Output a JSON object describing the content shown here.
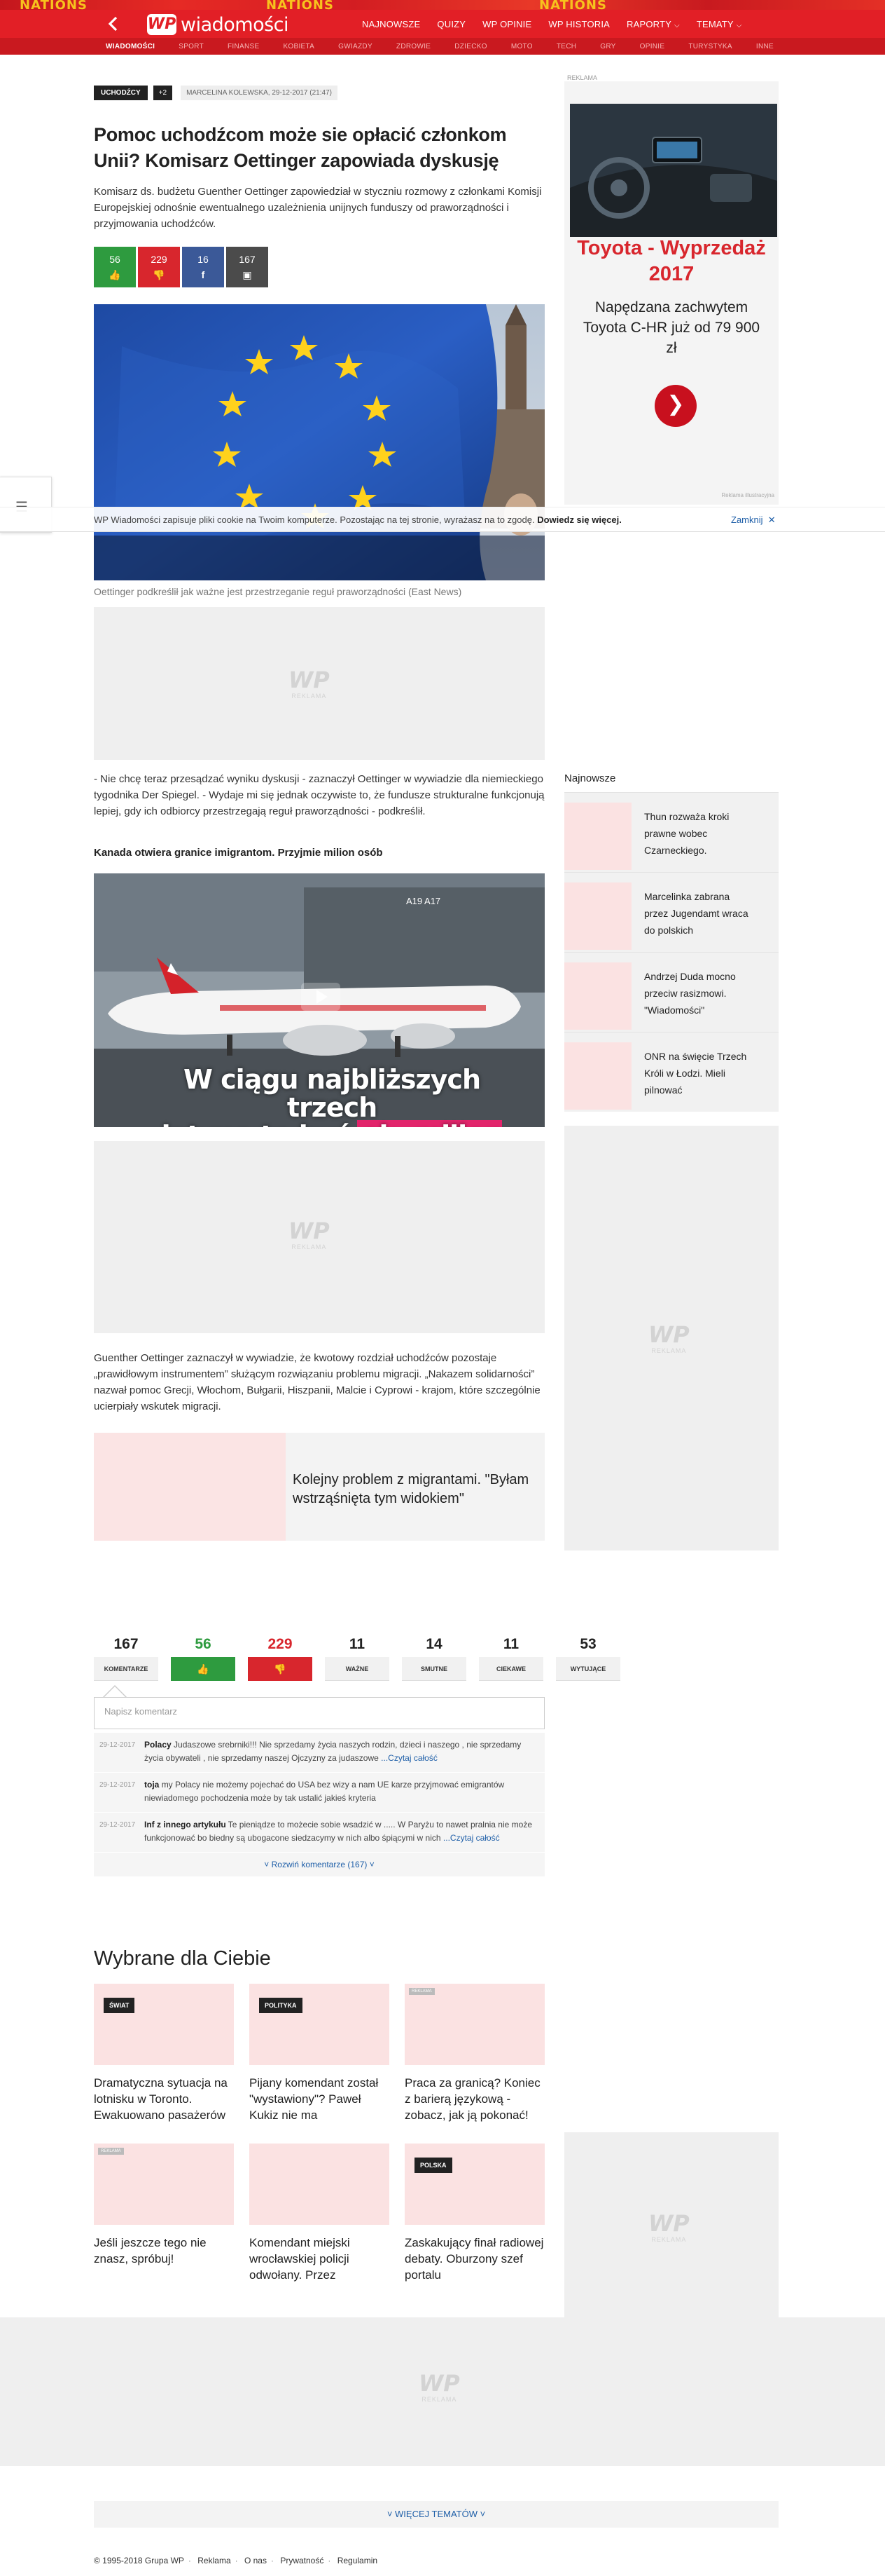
{
  "header": {
    "promo_text": "NATIONS",
    "logo_mark": "WP",
    "logo_text": "wiadomości",
    "back_icon": "chevron-left-icon",
    "top_nav": [
      {
        "label": "NAJNOWSZE"
      },
      {
        "label": "QUIZY"
      },
      {
        "label": "WP OPINIE"
      },
      {
        "label": "WP HISTORIA"
      },
      {
        "label": "RAPORTY"
      },
      {
        "label": "TEMATY"
      }
    ],
    "sub_nav": [
      {
        "label": "WIADOMOŚCI"
      },
      {
        "label": "SPORT"
      },
      {
        "label": "FINANSE"
      },
      {
        "label": "KOBIETA"
      },
      {
        "label": "GWIAZDY"
      },
      {
        "label": "ZDROWIE"
      },
      {
        "label": "DZIECKO"
      },
      {
        "label": "MOTO"
      },
      {
        "label": "TECH"
      },
      {
        "label": "GRY"
      },
      {
        "label": "OPINIE"
      },
      {
        "label": "TURYSTYKA"
      },
      {
        "label": "INNE"
      }
    ],
    "brand_color": "#e21f26"
  },
  "article": {
    "tag": "UCHODŹCY",
    "tag_more": "+2",
    "meta": "MARCELINA KOLEWSKA, 29-12-2017 (21:47)",
    "title": "Pomoc uchodźcom może sie opłacić członkom Unii? Komisarz Oettinger zapowiada dyskusję",
    "lead": "Komisarz ds. budżetu Guenther Oettinger zapowiedział w styczniu rozmowy z członkami Komisji Europejskiej odnośnie ewentualnego uzależnienia unijnych funduszy od praworządności i przyjmowania uchodźców.",
    "votes": {
      "up": "56",
      "down": "229",
      "facebook": "16",
      "comments": "167"
    },
    "caption": "Oettinger podkreślił jak ważne jest przestrzeganie reguł praworządności (East News)",
    "para1": "- Nie chcę teraz przesądzać wyniku dyskusji - zaznaczył Oettinger w wywiadzie dla niemieckiego tygodnika Der Spiegel. - Wydaje mi się jednak oczywiste to, że fundusze strukturalne funkcjonują lepiej, gdy ich odbiorcy przestrzegają reguł praworządności - podkreślił.",
    "video_heading": "Kanada otwiera granice imigrantom. Przyjmie milion osób",
    "video_caption_line1": "W ciągu najbliższych trzech",
    "video_caption_line2": "lat ma to być",
    "video_caption_highlight": "ok. milion osób",
    "video_tail_label": "A19 A17",
    "para2": "Guenther Oettinger zaznaczył w wywiadzie, że kwotowy rozdział uchodźców pozostaje „prawidłowym instrumentem” służącym rozwiązaniu problemu migracji. „Nakazem solidarności” nazwał pomoc Grecji, Włochom, Bułgarii, Hiszpanii, Malcie i Cyprowi - krajom, które szczególnie ucierpiały wskutek migracji.",
    "related": "Kolejny problem z migrantami. \"Byłam wstrząśnięta tym widokiem\""
  },
  "ads": {
    "reklama_label": "REKLAMA",
    "wp_mark": "WP",
    "side_label": "REKLAMA",
    "toyota_title": "Toyota - Wyprzedaż 2017",
    "toyota_text": "Napędzana zachwytem Toyota C-HR już od 79 900 zł",
    "toyota_credit": "Reklama illustracyjna",
    "toyota_btn_icon": "chevron-right-icon"
  },
  "cookie": {
    "text": "WP Wiadomości zapisuje pliki cookie na Twoim komputerze. Pozostając na tej stronie, wyrażasz na to zgodę.",
    "link": "Dowiedz się więcej.",
    "close": "Zamknij"
  },
  "sidebar": {
    "najnowsze_heading": "Najnowsze",
    "najnowsze": [
      {
        "title": "Thun rozważa kroki prawne wobec Czarneckiego."
      },
      {
        "title": "Marcelinka zabrana przez Jugendamt wraca do polskich"
      },
      {
        "title": "Andrzej Duda mocno przeciw rasizmowi. \"Wiadomości\""
      },
      {
        "title": "ONR na święcie Trzech Króli w Łodzi. Mieli pilnować"
      }
    ]
  },
  "reactions": [
    {
      "count": "167",
      "label": "KOMENTARZE"
    },
    {
      "count": "56",
      "label": "👍"
    },
    {
      "count": "229",
      "label": "👎"
    },
    {
      "count": "11",
      "label": "WAŻNE"
    },
    {
      "count": "14",
      "label": "SMUTNE"
    },
    {
      "count": "11",
      "label": "CIEKAWE"
    },
    {
      "count": "53",
      "label": "WYTUJĄCE"
    }
  ],
  "comments": {
    "placeholder": "Napisz komentarz",
    "items": [
      {
        "date": "29-12-2017",
        "author": "Polacy",
        "text": "Judaszowe srebrniki!!! Nie sprzedamy życia naszych rodzin, dzieci i naszego , nie sprzedamy życia obywateli , nie sprzedamy naszej Ojczyzny za judaszowe",
        "more": "...Czytaj całość"
      },
      {
        "date": "29-12-2017",
        "author": "toja",
        "text": "my Polacy nie możemy pojechać do USA bez wizy a nam UE karze przyjmować emigrantów niewiadomego pochodzenia może by tak ustalić jakieś kryteria",
        "more": ""
      },
      {
        "date": "29-12-2017",
        "author": "Inf z innego artykułu",
        "text": "Te pieniądze to możecie sobie wsadzić w ..... W Paryżu to nawet pralnia nie może funkcjonować bo biedny są ubogacone siedzacymy w nich albo śpiącymi w nich",
        "more": "...Czytaj całość"
      }
    ],
    "expand": "˅ Rozwiń komentarze (167) ˅"
  },
  "wybrane": {
    "heading": "Wybrane dla Ciebie",
    "cards": [
      {
        "badge": "ŚWIAT",
        "rekl": "",
        "title": "Dramatyczna sytuacja na lotnisku w Toronto. Ewakuowano pasażerów"
      },
      {
        "badge": "POLITYKA",
        "rekl": "",
        "title": "Pijany komendant został \"wystawiony\"? Paweł Kukiz nie ma"
      },
      {
        "badge": "",
        "rekl": "REKLAMA",
        "title": "Praca za granicą? Koniec z barierą językową - zobacz, jak ją pokonać!"
      },
      {
        "badge": "",
        "rekl": "REKLAMA",
        "title": "Jeśli jeszcze tego nie znasz, spróbuj!"
      },
      {
        "badge": "",
        "rekl": "",
        "title": "Komendant miejski wrocławskiej policji odwołany. Przez"
      },
      {
        "badge": "POLSKA",
        "rekl": "",
        "title": "Zaskakujący finał radiowej debaty. Oburzony szef portalu"
      }
    ]
  },
  "more_topics": "˅ WIĘCEJ TEMATÓW ˅",
  "footer": {
    "copyright": "© 1995-2018 Grupa WP",
    "links": [
      "Reklama",
      "O nas",
      "Prywatność",
      "Regulamin"
    ]
  }
}
